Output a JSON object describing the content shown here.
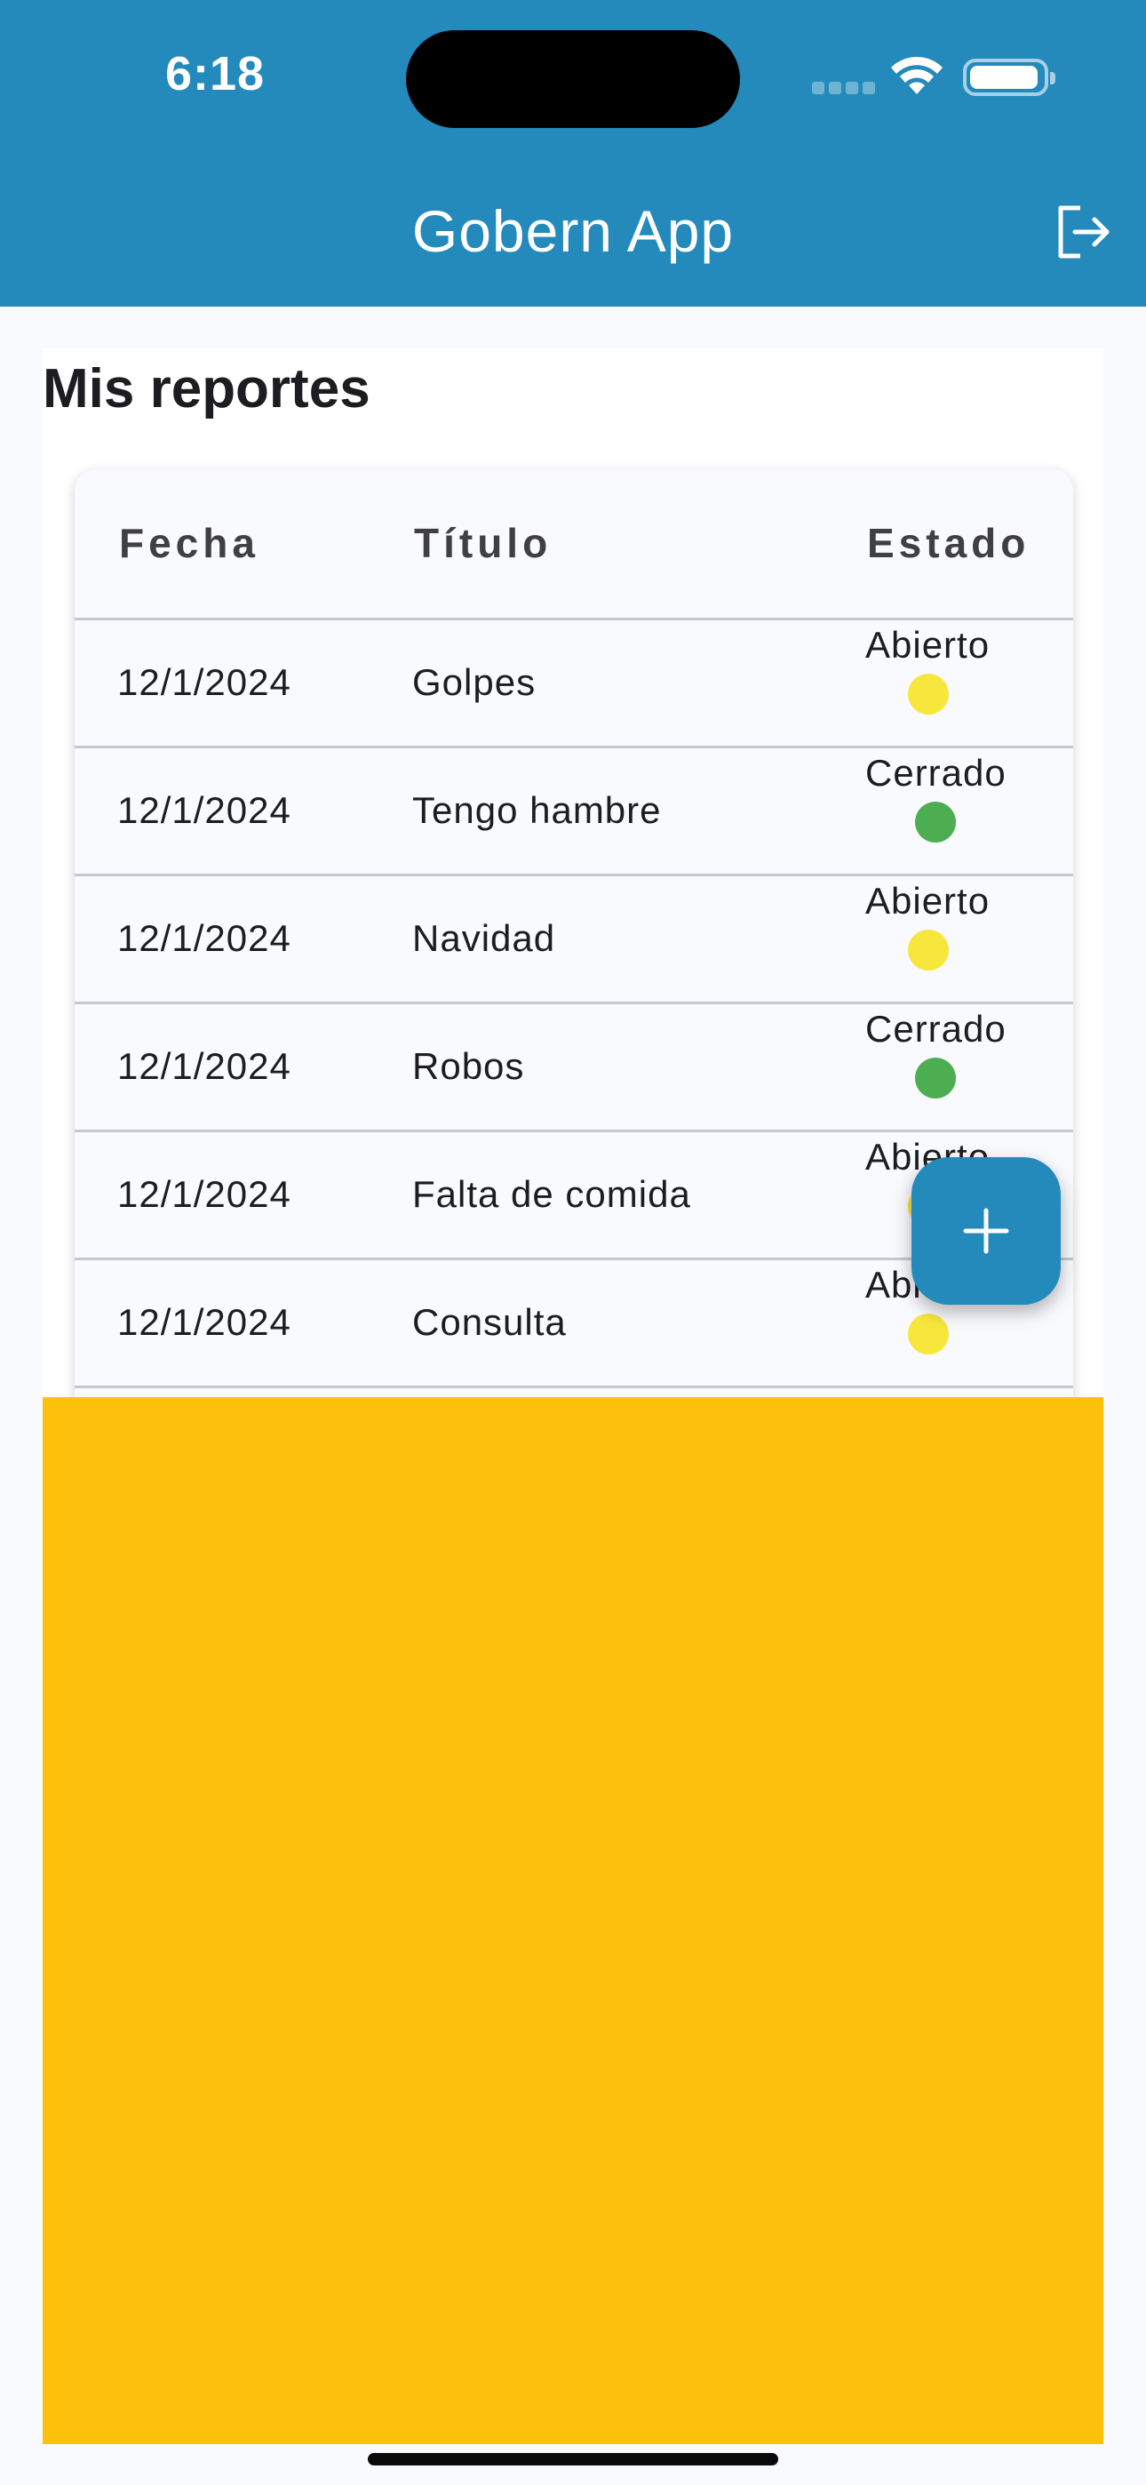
{
  "status_bar": {
    "time": "6:18"
  },
  "app_bar": {
    "title": "Gobern App",
    "logout_icon": "logout-icon"
  },
  "page": {
    "title": "Mis reportes"
  },
  "table": {
    "headers": [
      "Fecha",
      "Título",
      "Estado"
    ],
    "rows": [
      {
        "fecha": "12/1/2024",
        "titulo": "Golpes",
        "estado": "Abierto",
        "status_color": "#f7e63c"
      },
      {
        "fecha": "12/1/2024",
        "titulo": "Tengo hambre",
        "estado": "Cerrado",
        "status_color": "#4cae50"
      },
      {
        "fecha": "12/1/2024",
        "titulo": "Navidad",
        "estado": "Abierto",
        "status_color": "#f7e63c"
      },
      {
        "fecha": "12/1/2024",
        "titulo": "Robos",
        "estado": "Cerrado",
        "status_color": "#4cae50"
      },
      {
        "fecha": "12/1/2024",
        "titulo": "Falta de comida",
        "estado": "Abierto",
        "status_color": "#f7e63c"
      },
      {
        "fecha": "12/1/2024",
        "titulo": "Consulta",
        "estado": "Abierto",
        "status_color": "#f7e63c"
      }
    ]
  },
  "fab": {
    "icon": "plus-icon"
  },
  "colors": {
    "primary": "#238abb",
    "banner": "#fec10b",
    "open": "#f7e63c",
    "closed": "#4cae50"
  }
}
